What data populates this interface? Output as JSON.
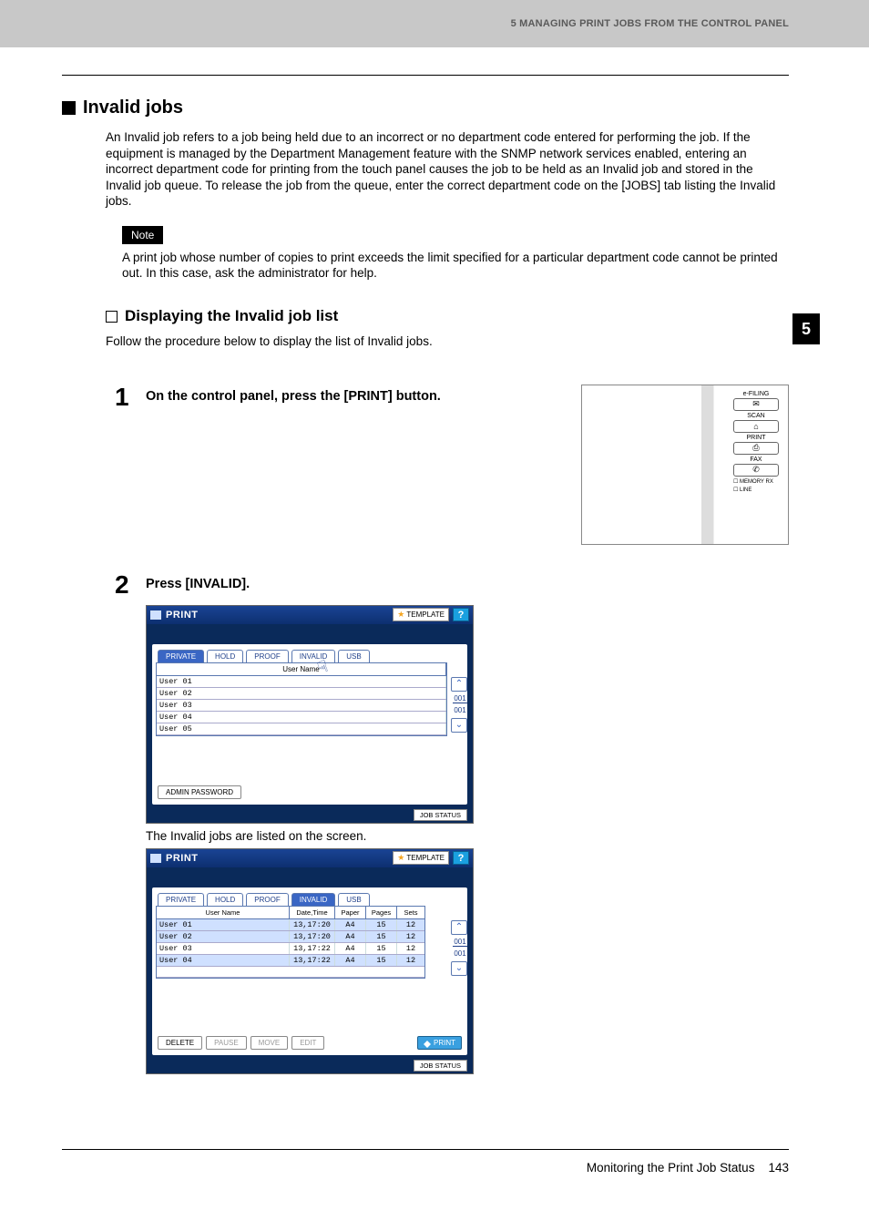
{
  "header": {
    "chapter_header": "5 MANAGING PRINT JOBS FROM THE CONTROL PANEL"
  },
  "chapter_tab": "5",
  "section": {
    "h1": "Invalid jobs",
    "body": "An Invalid job refers to a job being held due to an incorrect or no department code entered for performing the job. If the equipment is managed by the Department Management feature with the SNMP network services enabled, entering an incorrect department code for printing from the touch panel causes the job to be held as an Invalid job and stored in the Invalid job queue. To release the job from the queue, enter the correct department code on the [JOBS] tab listing the Invalid jobs.",
    "note_label": "Note",
    "note_text": "A print job whose number of copies to print exceeds the limit specified for a particular department code cannot be printed out. In this case, ask the administrator for help.",
    "h2": "Displaying the Invalid job list",
    "follow": "Follow the procedure below to display the list of Invalid jobs."
  },
  "steps": {
    "s1": {
      "num": "1",
      "text": "On the control panel, press the [PRINT] button."
    },
    "s2": {
      "num": "2",
      "text": "Press [INVALID]."
    },
    "caption": "The Invalid jobs are listed on the screen."
  },
  "panel": {
    "labels": [
      "e-FILING",
      "SCAN",
      "PRINT",
      "FAX"
    ],
    "mem1": "MEMORY RX",
    "mem2": "LINE"
  },
  "screen1": {
    "title": "PRINT",
    "template": "TEMPLATE",
    "help": "?",
    "tabs": [
      "PRIVATE",
      "HOLD",
      "PROOF",
      "INVALID",
      "USB"
    ],
    "th_user": "User Name",
    "users": [
      "User 01",
      "User 02",
      "User 03",
      "User 04",
      "User 05"
    ],
    "scroll_top": "001",
    "scroll_bot": "001",
    "admin": "ADMIN PASSWORD",
    "jobstatus": "JOB STATUS"
  },
  "screen2": {
    "title": "PRINT",
    "template": "TEMPLATE",
    "help": "?",
    "tabs": [
      "PRIVATE",
      "HOLD",
      "PROOF",
      "INVALID",
      "USB"
    ],
    "headers": {
      "user": "User Name",
      "dt": "Date,Time",
      "paper": "Paper",
      "pages": "Pages",
      "sets": "Sets"
    },
    "rows": [
      {
        "user": "User 01",
        "dt": "13,17:20",
        "paper": "A4",
        "pages": "15",
        "sets": "12",
        "sel": true
      },
      {
        "user": "User 02",
        "dt": "13,17:20",
        "paper": "A4",
        "pages": "15",
        "sets": "12",
        "sel": true
      },
      {
        "user": "User 03",
        "dt": "13,17:22",
        "paper": "A4",
        "pages": "15",
        "sets": "12",
        "sel": false
      },
      {
        "user": "User 04",
        "dt": "13,17:22",
        "paper": "A4",
        "pages": "15",
        "sets": "12",
        "sel": true
      }
    ],
    "scroll_top": "001",
    "scroll_bot": "001",
    "actions": {
      "delete": "DELETE",
      "pause": "PAUSE",
      "move": "MOVE",
      "edit": "EDIT",
      "print": "PRINT"
    },
    "jobstatus": "JOB STATUS"
  },
  "footer": {
    "text": "Monitoring the Print Job Status",
    "page": "143"
  }
}
